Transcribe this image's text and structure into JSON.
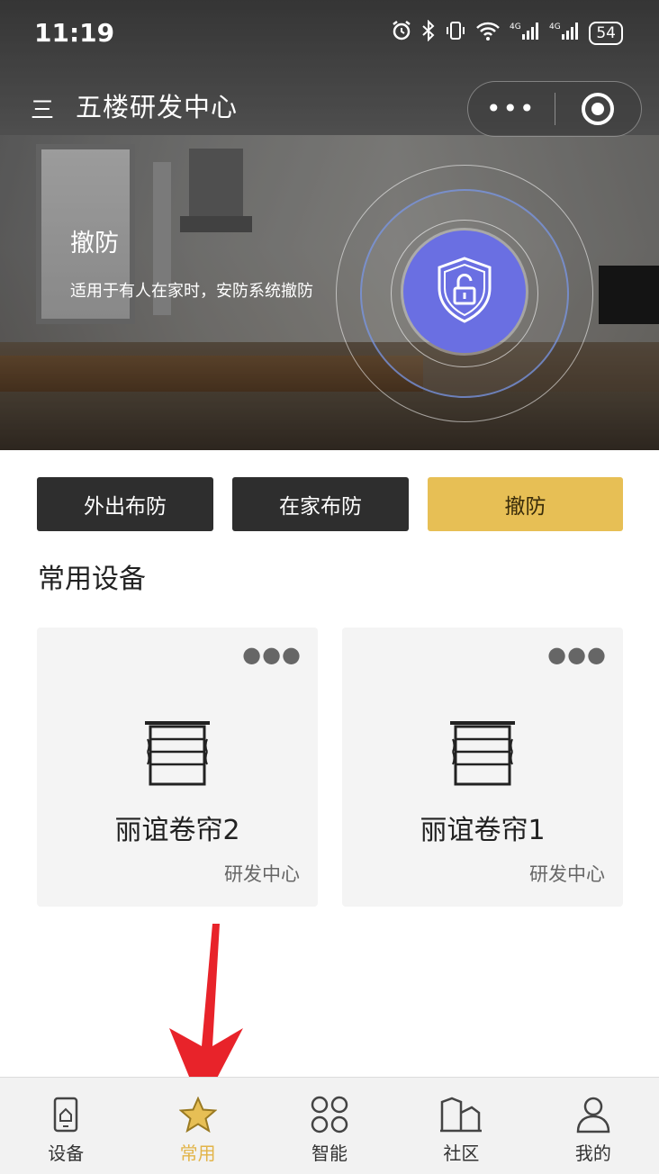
{
  "status_bar": {
    "time": "11:19",
    "battery": "54"
  },
  "header": {
    "menu_icon": "三",
    "title": "五楼研发中心"
  },
  "security": {
    "mode_title": "撤防",
    "mode_description": "适用于有人在家时，安防系统撤防",
    "buttons": [
      "外出布防",
      "在家布防",
      "撤防"
    ],
    "active_button": "撤防"
  },
  "section": {
    "title": "常用设备"
  },
  "devices": [
    {
      "name": "丽谊卷帘2",
      "room": "研发中心",
      "icon": "roller-blind-icon"
    },
    {
      "name": "丽谊卷帘1",
      "room": "研发中心",
      "icon": "roller-blind-icon"
    }
  ],
  "tabs": [
    {
      "label": "设备",
      "icon": "device-icon"
    },
    {
      "label": "常用",
      "icon": "star-icon"
    },
    {
      "label": "智能",
      "icon": "smart-icon"
    },
    {
      "label": "社区",
      "icon": "community-icon"
    },
    {
      "label": "我的",
      "icon": "profile-icon"
    }
  ],
  "active_tab": "常用",
  "colors": {
    "accent": "#e7bf55",
    "shield": "#6a6fe2",
    "dark_button": "#2e2e2e",
    "arrow": "#e8232a"
  }
}
